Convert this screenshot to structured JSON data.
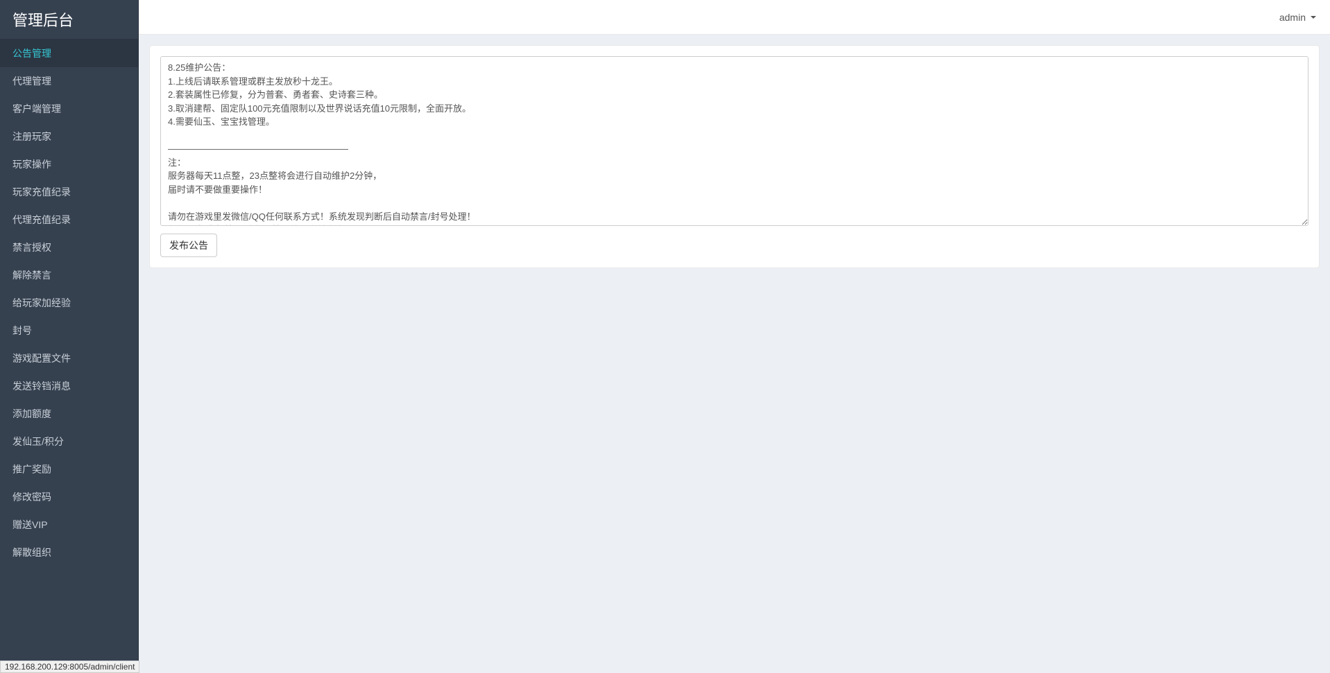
{
  "sidebar": {
    "title": "管理后台",
    "items": [
      {
        "label": "公告管理",
        "active": true
      },
      {
        "label": "代理管理",
        "active": false
      },
      {
        "label": "客户端管理",
        "active": false
      },
      {
        "label": "注册玩家",
        "active": false
      },
      {
        "label": "玩家操作",
        "active": false
      },
      {
        "label": "玩家充值纪录",
        "active": false
      },
      {
        "label": "代理充值纪录",
        "active": false
      },
      {
        "label": "禁言授权",
        "active": false
      },
      {
        "label": "解除禁言",
        "active": false
      },
      {
        "label": "给玩家加经验",
        "active": false
      },
      {
        "label": "封号",
        "active": false
      },
      {
        "label": "游戏配置文件",
        "active": false
      },
      {
        "label": "发送铃铛消息",
        "active": false
      },
      {
        "label": "添加额度",
        "active": false
      },
      {
        "label": "发仙玉/积分",
        "active": false
      },
      {
        "label": "推广奖励",
        "active": false
      },
      {
        "label": "修改密码",
        "active": false
      },
      {
        "label": "赠送VIP",
        "active": false
      },
      {
        "label": "解散组织",
        "active": false
      }
    ]
  },
  "topbar": {
    "username": "admin"
  },
  "content": {
    "announcement_text": "8.25维护公告：\n1.上线后请联系管理或群主发放秒十龙王。\n2.套装属性已修复，分为普套、勇者套、史诗套三种。\n3.取消建帮、固定队100元充值限制以及世界说话充值10元限制，全面开放。\n4.需要仙玉、宝宝找管理。\n\n————————————————————\n注：\n服务器每天11点整，23点整将会进行自动维护2分钟，\n届时请不要做重要操作！\n\n请勿在游戏里发微信/QQ任何联系方式！系统发现判断后自动禁言/封号处理！\n任何广告/变相拉人/建帮派拉人的都会禁言/封号！",
    "publish_button": "发布公告"
  },
  "statusbar": {
    "url": "192.168.200.129:8005/admin/client"
  }
}
